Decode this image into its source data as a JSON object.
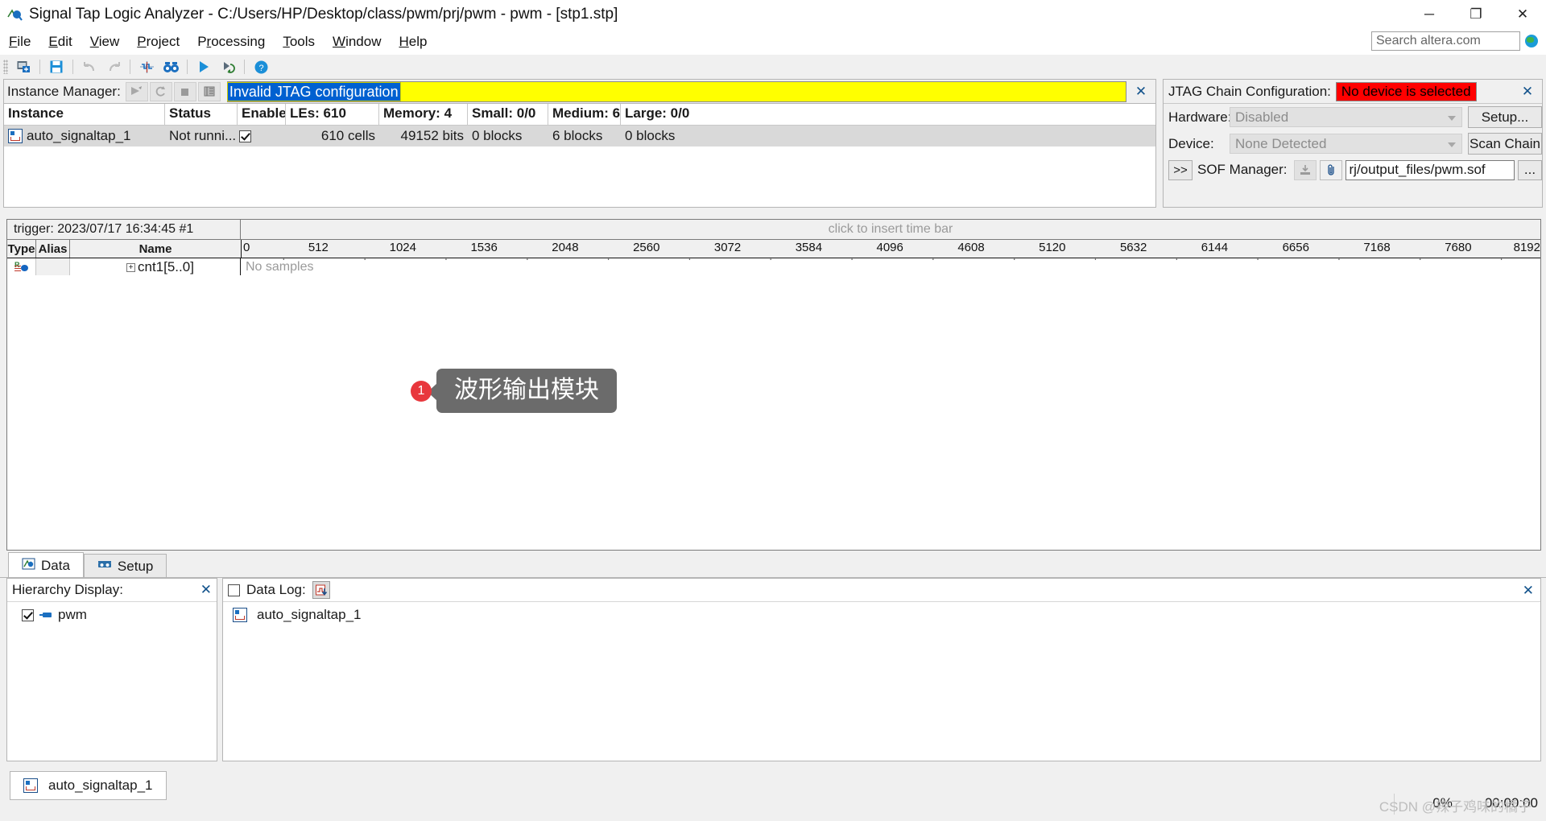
{
  "window": {
    "title": "Signal Tap Logic Analyzer - C:/Users/HP/Desktop/class/pwm/prj/pwm - pwm - [stp1.stp]",
    "minimize": "─",
    "maximize": "❐",
    "close": "✕"
  },
  "menu": {
    "items": [
      {
        "label": "File",
        "accel": "F"
      },
      {
        "label": "Edit",
        "accel": "E"
      },
      {
        "label": "View",
        "accel": "V"
      },
      {
        "label": "Project",
        "accel": "P"
      },
      {
        "label": "Processing",
        "accel": "r"
      },
      {
        "label": "Tools",
        "accel": "T"
      },
      {
        "label": "Window",
        "accel": "W"
      },
      {
        "label": "Help",
        "accel": "H"
      }
    ]
  },
  "search": {
    "placeholder": "Search altera.com",
    "value": "Search altera.com",
    "icon": "globe-icon"
  },
  "toolbar": {
    "buttons": [
      {
        "name": "new-stp-icon",
        "glyph": "❐"
      },
      {
        "name": "save-icon",
        "glyph": "ὋE"
      },
      {
        "name": "undo-icon",
        "glyph": "↶"
      },
      {
        "name": "redo-icon",
        "glyph": "↷"
      },
      {
        "name": "trigger-icon",
        "glyph": "✳"
      },
      {
        "name": "find-icon",
        "glyph": "◎◎"
      },
      {
        "name": "run-analysis-icon",
        "glyph": "▶"
      },
      {
        "name": "autorun-icon",
        "glyph": "⟳"
      },
      {
        "name": "help-icon",
        "glyph": "?"
      }
    ]
  },
  "instance_manager": {
    "title": "Instance Manager:",
    "buttons": [
      {
        "name": "run-analysis-button",
        "glyph": "➤"
      },
      {
        "name": "autorun-analysis-button",
        "glyph": "↺"
      },
      {
        "name": "stop-analysis-button",
        "glyph": "■"
      },
      {
        "name": "read-data-button",
        "glyph": "▤"
      }
    ],
    "status_message": "Invalid JTAG configuration",
    "close_label": "✕",
    "columns": [
      "Instance",
      "Status",
      "Enable",
      "LEs: 610",
      "Memory: 4",
      "Small: 0/0",
      "Medium: 6,",
      "Large: 0/0"
    ],
    "rows": [
      {
        "instance": "auto_signaltap_1",
        "status": "Not runni...",
        "enable": true,
        "les": "610 cells",
        "memory": "49152 bits",
        "small": "0 blocks",
        "medium": "6 blocks",
        "large": "0 blocks"
      }
    ]
  },
  "jtag": {
    "title": "JTAG Chain Configuration:",
    "status": "No device is selected",
    "status_color": "#ff0000",
    "close_label": "✕",
    "hardware_label": "Hardware:",
    "hardware_value": "Disabled",
    "setup_button": "Setup...",
    "device_label": "Device:",
    "device_value": "None Detected",
    "scan_button": "Scan Chain",
    "expand_button": ">>",
    "sof_label": "SOF Manager:",
    "sof_path": "rj/output_files/pwm.sof",
    "sof_browse": "...",
    "sof_program_icon": "program-device-icon",
    "sof_attach_icon": "attach-icon"
  },
  "waveform": {
    "trigger_label": "trigger: 2023/07/17 16:34:45  #1",
    "time_bar_hint": "click to insert time bar",
    "columns": {
      "type": "Type",
      "alias": "Alias",
      "name": "Name"
    },
    "signals": [
      {
        "name": "cnt1[5..0]",
        "data": "No samples",
        "expander": "+",
        "type_icon": "signal-group-icon"
      }
    ],
    "ruler_ticks": [
      "0",
      "512",
      "1024",
      "1536",
      "2048",
      "2560",
      "3072",
      "3584",
      "4096",
      "4608",
      "5120",
      "5632",
      "6144",
      "6656",
      "7168",
      "7680",
      "8192"
    ]
  },
  "annotation": {
    "number": "1",
    "text": "波形输出模块"
  },
  "tabs": [
    {
      "label": "Data",
      "active": true,
      "icon": "data-tab-icon"
    },
    {
      "label": "Setup",
      "active": false,
      "icon": "setup-tab-icon"
    }
  ],
  "hierarchy": {
    "title": "Hierarchy Display:",
    "close_label": "✕",
    "items": [
      {
        "label": "pwm",
        "checked": true,
        "icon": "entity-icon"
      }
    ]
  },
  "data_log": {
    "title": "Data Log:",
    "checked": false,
    "close_label": "✕",
    "icon": "data-log-icon",
    "items": [
      {
        "label": "auto_signaltap_1",
        "icon": "stp-instance-icon"
      }
    ]
  },
  "statusbar": {
    "instance_tab": "auto_signaltap_1",
    "progress": "0%",
    "elapsed": "00:00:00",
    "watermark": "CSDN @辣子鸡味的橘子"
  }
}
